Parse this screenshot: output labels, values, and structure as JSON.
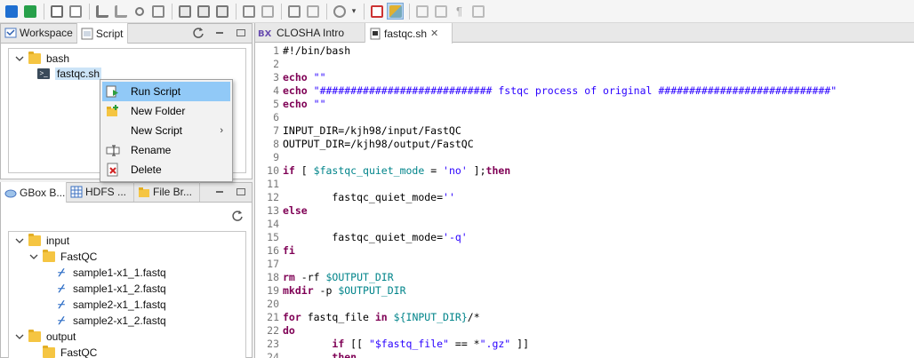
{
  "toolbar": {
    "buttons": [
      "app-icon",
      "app-green-icon",
      "new-item-icon",
      "edit-icon",
      "workflow-icon",
      "edit-workflow-icon",
      "share-icon",
      "export-icon",
      "package-icon",
      "save-icon",
      "save-as-icon",
      "upload-icon",
      "download-icon",
      "import-icon",
      "edit-file-icon",
      "run-icon",
      "dropdown-icon",
      "delete-icon",
      "highlight-icon",
      "format-icon",
      "document-icon",
      "pilcrow-icon",
      "copy-icon"
    ]
  },
  "top_left_panel": {
    "tabs": [
      {
        "label": "Workspace",
        "icon": "workspace-icon"
      },
      {
        "label": "Script",
        "icon": "script-icon"
      }
    ],
    "tree": [
      {
        "label": "bash",
        "type": "folder",
        "expanded": true
      },
      {
        "label": "fastqc.sh",
        "type": "script",
        "selected": true
      }
    ]
  },
  "context_menu": {
    "items": [
      {
        "label": "Run Script",
        "icon": "run-script-icon",
        "highlighted": true
      },
      {
        "label": "New Folder",
        "icon": "new-folder-icon"
      },
      {
        "label": "New Script",
        "icon": "",
        "submenu": true
      },
      {
        "label": "Rename",
        "icon": "rename-icon"
      },
      {
        "label": "Delete",
        "icon": "delete-icon"
      }
    ],
    "submenu_arrow": "›"
  },
  "bottom_left_panel": {
    "tabs": [
      {
        "label": "GBox B...",
        "icon": "gbox-icon"
      },
      {
        "label": "HDFS ...",
        "icon": "hdfs-icon"
      },
      {
        "label": "File Br...",
        "icon": "file-browser-icon"
      }
    ],
    "tree": [
      {
        "label": "input",
        "type": "folder",
        "level": 0
      },
      {
        "label": "FastQC",
        "type": "folder",
        "level": 1
      },
      {
        "label": "sample1-x1_1.fastq",
        "type": "fastq",
        "level": 2
      },
      {
        "label": "sample1-x1_2.fastq",
        "type": "fastq",
        "level": 2
      },
      {
        "label": "sample2-x1_1.fastq",
        "type": "fastq",
        "level": 2
      },
      {
        "label": "sample2-x1_2.fastq",
        "type": "fastq",
        "level": 2
      },
      {
        "label": "output",
        "type": "folder",
        "level": 0
      },
      {
        "label": "FastQC",
        "type": "folder",
        "level": 1
      }
    ]
  },
  "editor": {
    "tabs": [
      {
        "label": "CLOSHA Intro",
        "icon": "closha-icon"
      },
      {
        "label": "fastqc.sh",
        "icon": "script-file-icon",
        "close": "✕",
        "active": true
      }
    ],
    "lines": [
      [
        [
          "t",
          "#!/bin/bash"
        ]
      ],
      [],
      [
        [
          "k",
          "echo"
        ],
        [
          "t",
          " "
        ],
        [
          "s",
          "\"\""
        ]
      ],
      [
        [
          "k",
          "echo"
        ],
        [
          "t",
          " "
        ],
        [
          "s",
          "\"############################ fstqc process of original ############################\""
        ]
      ],
      [
        [
          "k",
          "echo"
        ],
        [
          "t",
          " "
        ],
        [
          "s",
          "\"\""
        ]
      ],
      [],
      [
        [
          "t",
          "INPUT_DIR=/kjh98/input/FastQC"
        ]
      ],
      [
        [
          "t",
          "OUTPUT_DIR=/kjh98/output/FastQC"
        ]
      ],
      [],
      [
        [
          "k",
          "if"
        ],
        [
          "t",
          " [ "
        ],
        [
          "v",
          "$fastqc_quiet_mode"
        ],
        [
          "t",
          " = "
        ],
        [
          "s",
          "'no'"
        ],
        [
          "t",
          " ];"
        ],
        [
          "k",
          "then"
        ]
      ],
      [],
      [
        [
          "t",
          "        fastqc_quiet_mode="
        ],
        [
          "s",
          "''"
        ]
      ],
      [
        [
          "k",
          "else"
        ]
      ],
      [],
      [
        [
          "t",
          "        fastqc_quiet_mode="
        ],
        [
          "s",
          "'-q'"
        ]
      ],
      [
        [
          "k",
          "fi"
        ]
      ],
      [],
      [
        [
          "k",
          "rm"
        ],
        [
          "t",
          " -rf "
        ],
        [
          "v",
          "$OUTPUT_DIR"
        ]
      ],
      [
        [
          "k",
          "mkdir"
        ],
        [
          "t",
          " -p "
        ],
        [
          "v",
          "$OUTPUT_DIR"
        ]
      ],
      [],
      [
        [
          "k",
          "for"
        ],
        [
          "t",
          " fastq_file "
        ],
        [
          "k",
          "in"
        ],
        [
          "t",
          " "
        ],
        [
          "v",
          "${INPUT_DIR}"
        ],
        [
          "t",
          "/*"
        ]
      ],
      [
        [
          "k",
          "do"
        ]
      ],
      [
        [
          "t",
          "        "
        ],
        [
          "k",
          "if"
        ],
        [
          "t",
          " [[ "
        ],
        [
          "s",
          "\"$fastq_file\""
        ],
        [
          "t",
          " == *"
        ],
        [
          "s",
          "\".gz\""
        ],
        [
          "t",
          " ]]"
        ]
      ],
      [
        [
          "t",
          "        "
        ],
        [
          "k",
          "then"
        ]
      ]
    ]
  }
}
